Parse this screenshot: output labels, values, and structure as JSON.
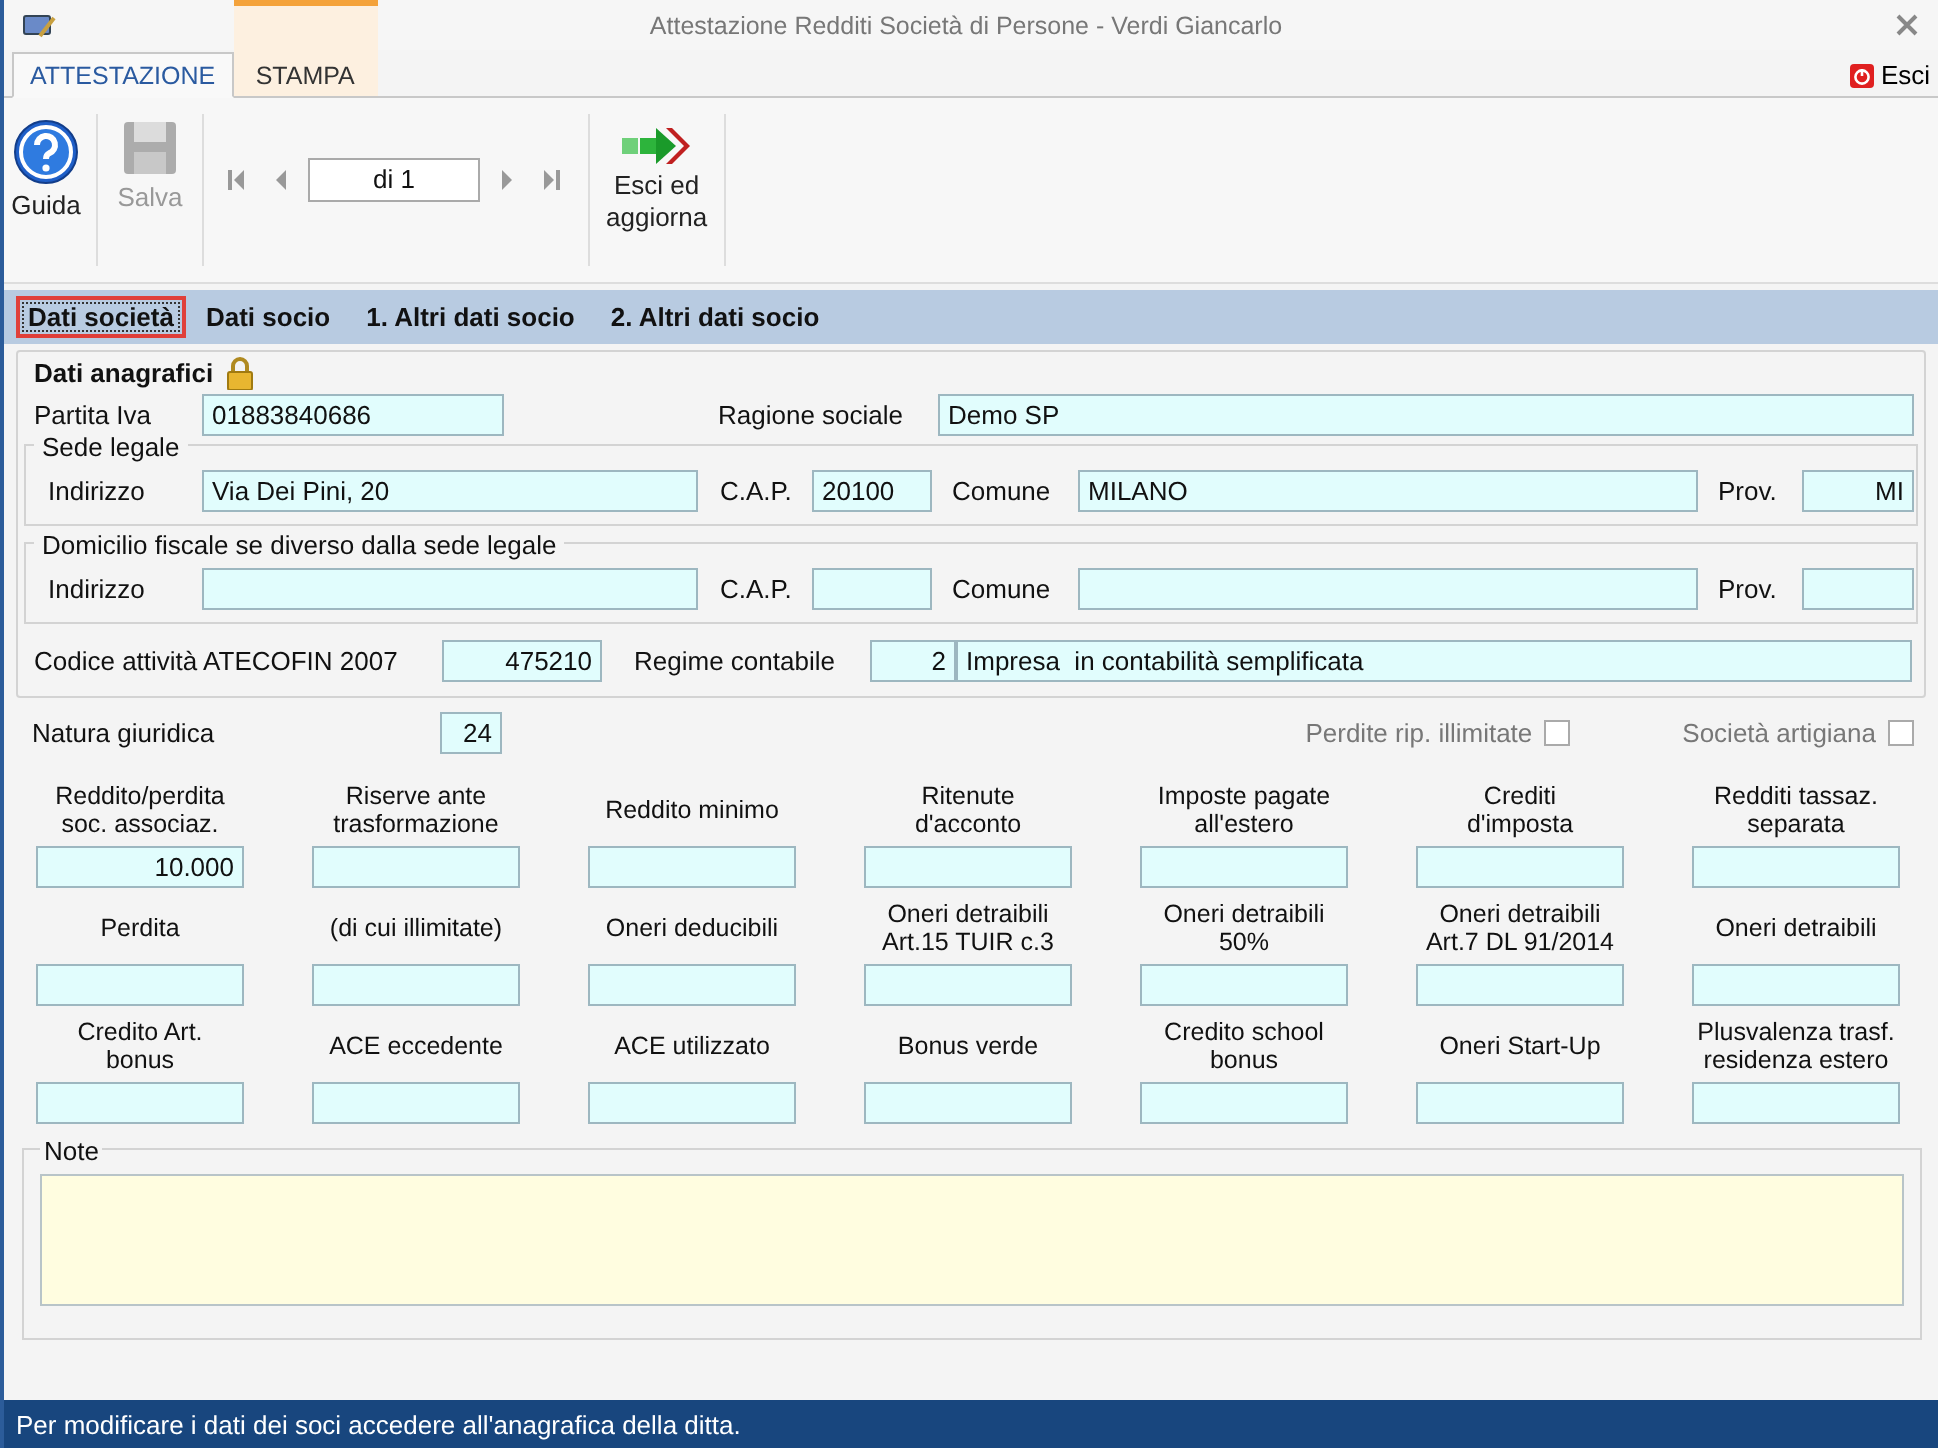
{
  "window": {
    "title": "Attestazione Redditi Società di Persone - Verdi Giancarlo"
  },
  "ribbon_tabs": [
    {
      "label": "ATTESTAZIONE",
      "selected": true
    },
    {
      "label": "STAMPA",
      "selected": false
    }
  ],
  "exit_link": {
    "label": "Esci"
  },
  "toolbar": {
    "buttons": [
      {
        "label": "Guida",
        "kind": "help",
        "disabled": false
      },
      {
        "label": "Salva",
        "kind": "save",
        "disabled": true
      }
    ],
    "navigator": {
      "value": "di 1"
    },
    "exit_button": {
      "label": "Esci ed\naggiorna"
    }
  },
  "section_tabs": [
    {
      "label": "Dati società",
      "selected": true
    },
    {
      "label": "Dati socio",
      "selected": false
    },
    {
      "label": "1. Altri dati socio",
      "selected": false
    },
    {
      "label": "2. Altri dati socio",
      "selected": false
    }
  ],
  "dati_anagrafici": {
    "title": "Dati anagrafici",
    "locked": true,
    "partita_iva": {
      "label": "Partita Iva",
      "value": "01883840686"
    },
    "ragione_sociale": {
      "label": "Ragione sociale",
      "value": "Demo SP"
    },
    "addresses": [
      {
        "title": "Sede legale",
        "indirizzo": {
          "label": "Indirizzo",
          "value": "Via Dei Pini, 20"
        },
        "cap": {
          "label": "C.A.P.",
          "value": "20100"
        },
        "comune": {
          "label": "Comune",
          "value": "MILANO"
        },
        "prov": {
          "label": "Prov.",
          "value": "MI"
        }
      },
      {
        "title": "Domicilio fiscale se diverso dalla sede legale",
        "indirizzo": {
          "label": "Indirizzo"
        },
        "cap": {
          "label": "C.A.P."
        },
        "comune": {
          "label": "Comune"
        },
        "prov": {
          "label": "Prov."
        }
      }
    ],
    "codice_attivita": {
      "label": "Codice attività ATECOFIN 2007",
      "value": "475210"
    },
    "regime_contabile": {
      "label": "Regime contabile",
      "code": "2",
      "value": "Impresa  in contabilità semplificata"
    }
  },
  "natura_giuridica": {
    "label": "Natura giuridica",
    "value": "24"
  },
  "checkboxes": [
    {
      "label": "Perdite rip. illimitate",
      "checked": false
    },
    {
      "label": "Società artigiana",
      "checked": false
    }
  ],
  "amount_fields": [
    {
      "label": "Reddito/perdita\nsoc. associaz.",
      "value": "10.000"
    },
    {
      "label": "Riserve ante\ntrasformazione"
    },
    {
      "label": "Reddito minimo"
    },
    {
      "label": "Ritenute\nd'acconto"
    },
    {
      "label": "Imposte pagate\nall'estero"
    },
    {
      "label": "Crediti\nd'imposta"
    },
    {
      "label": "Redditi tassaz.\nseparata"
    },
    {
      "label": "Perdita"
    },
    {
      "label": "(di cui illimitate)"
    },
    {
      "label": "Oneri deducibili"
    },
    {
      "label": "Oneri detraibili\nArt.15 TUIR c.3"
    },
    {
      "label": "Oneri detraibili\n50%"
    },
    {
      "label": "Oneri detraibili\nArt.7 DL 91/2014"
    },
    {
      "label": "Oneri detraibili"
    },
    {
      "label": "Credito Art.\nbonus"
    },
    {
      "label": "ACE eccedente"
    },
    {
      "label": "ACE utilizzato"
    },
    {
      "label": "Bonus verde"
    },
    {
      "label": "Credito school\nbonus"
    },
    {
      "label": "Oneri Start-Up"
    },
    {
      "label": "Plusvalenza trasf.\nresidenza estero"
    }
  ],
  "note": {
    "label": "Note"
  },
  "status_bar": "Per modificare i dati dei soci accedere all'anagrafica della ditta."
}
